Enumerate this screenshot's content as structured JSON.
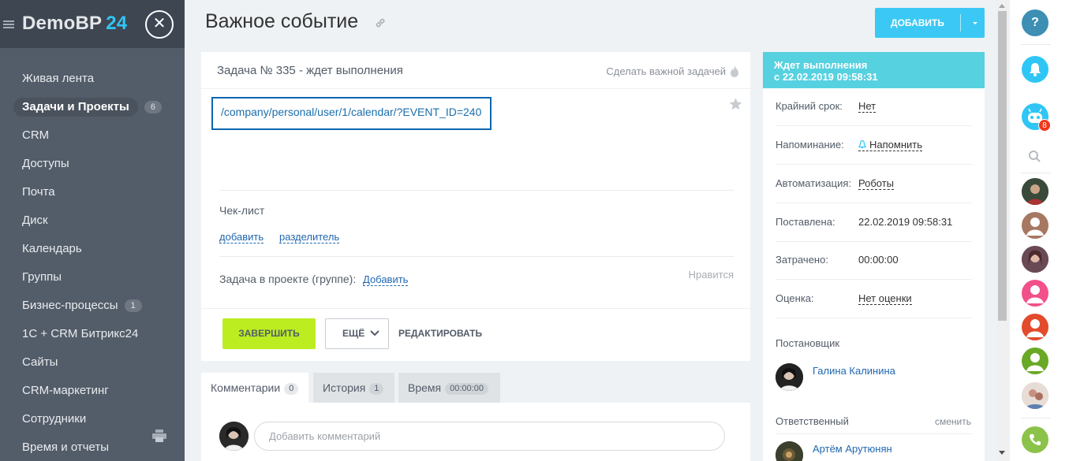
{
  "sidebar": {
    "brand_name": "DemoBP",
    "brand_number": "24",
    "items": [
      {
        "label": "Живая лента",
        "count": ""
      },
      {
        "label": "Задачи и Проекты",
        "count": "6"
      },
      {
        "label": "CRM",
        "count": ""
      },
      {
        "label": "Доступы",
        "count": ""
      },
      {
        "label": "Почта",
        "count": ""
      },
      {
        "label": "Диск",
        "count": ""
      },
      {
        "label": "Календарь",
        "count": ""
      },
      {
        "label": "Группы",
        "count": ""
      },
      {
        "label": "Бизнес-процессы",
        "count": "1"
      },
      {
        "label": "1С + CRM Битрикс24",
        "count": ""
      },
      {
        "label": "Сайты",
        "count": ""
      },
      {
        "label": "CRM-маркетинг",
        "count": ""
      },
      {
        "label": "Сотрудники",
        "count": ""
      },
      {
        "label": "Время и отчеты",
        "count": ""
      }
    ]
  },
  "header": {
    "title": "Важное событие",
    "add_button": "ДОБАВИТЬ"
  },
  "task": {
    "heading": "Задача № 335 - ждет выполнения",
    "make_important": "Сделать важной задачей",
    "description_link": "/company/personal/user/1/calendar/?EVENT_ID=240",
    "checklist_title": "Чек-лист",
    "checklist_add": "добавить",
    "checklist_separator": "разделитель",
    "project_label": "Задача в проекте (группе):",
    "project_add": "Добавить",
    "like": "Нравится",
    "btn_finish": "ЗАВЕРШИТЬ",
    "btn_more": "ЕЩЁ",
    "btn_edit": "РЕДАКТИРОВАТЬ"
  },
  "tabs": [
    {
      "label": "Комментарии",
      "count": "0"
    },
    {
      "label": "История",
      "count": "1"
    },
    {
      "label": "Время",
      "count": "00:00:00"
    }
  ],
  "comments": {
    "placeholder": "Добавить комментарий"
  },
  "status_panel": {
    "status_title": "Ждет выполнения",
    "status_since": "с 22.02.2019 09:58:31",
    "rows": [
      {
        "key": "Крайний срок:",
        "value": "Нет"
      },
      {
        "key": "Напоминание:",
        "value": "Напомнить"
      },
      {
        "key": "Автоматизация:",
        "value": "Роботы"
      },
      {
        "key": "Поставлена:",
        "value": "22.02.2019 09:58:31"
      },
      {
        "key": "Затрачено:",
        "value": "00:00:00"
      },
      {
        "key": "Оценка:",
        "value": "Нет оценки"
      }
    ],
    "creator_label": "Постановщик",
    "creator_name": "Галина Калинина",
    "responsible_label": "Ответственный",
    "responsible_change": "сменить",
    "responsible_name": "Артём Арутюнян"
  },
  "rightbar": {
    "help": "?",
    "bot_badge": "8"
  },
  "colors": {
    "accent": "#3bc8f5",
    "status_header": "#56d1e0",
    "finish_button": "#bbed21",
    "link": "#2067b0",
    "sidebar_bg": "#535c69"
  }
}
